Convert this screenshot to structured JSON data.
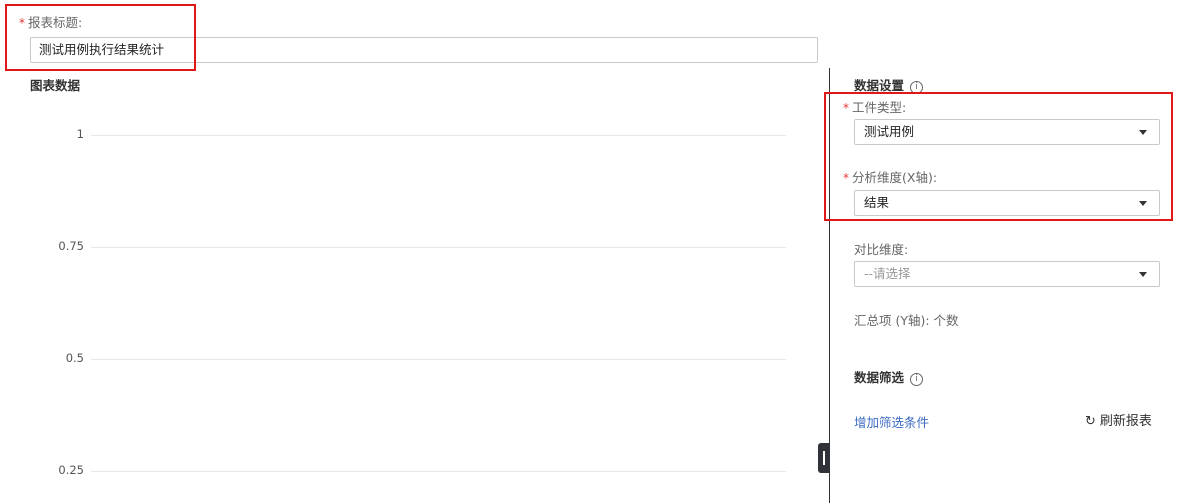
{
  "report_title": {
    "required_mark": "*",
    "label": "报表标题:",
    "value": "测试用例执行结果统计"
  },
  "chart_section": {
    "title": "图表数据"
  },
  "chart_data": {
    "type": "bar",
    "categories": [],
    "values": [],
    "title": "",
    "xlabel": "",
    "ylabel": "",
    "y_ticks": [
      "1",
      "0.75",
      "0.5",
      "0.25"
    ],
    "grid": true
  },
  "data_settings": {
    "title": "数据设置",
    "info_icon": "i",
    "work_item_type": {
      "required_mark": "*",
      "label": "工件类型:",
      "value": "测试用例"
    },
    "analysis_dimension": {
      "required_mark": "*",
      "label": "分析维度(X轴):",
      "value": "结果"
    },
    "compare_dimension": {
      "label": "对比维度:",
      "placeholder": "--请选择"
    },
    "summary": {
      "text": "汇总项 (Y轴): 个数"
    }
  },
  "data_filter": {
    "title": "数据筛选",
    "info_icon": "i",
    "add_filter_label": "增加筛选条件",
    "refresh_label": "刷新报表",
    "refresh_icon": "↻"
  },
  "colors": {
    "accent_red": "#e11818",
    "link_blue": "#3d6bc4"
  }
}
